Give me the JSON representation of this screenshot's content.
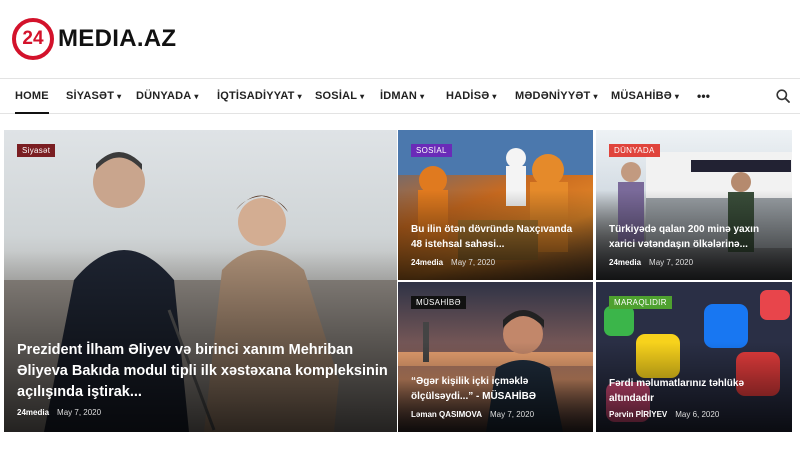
{
  "logo": {
    "mark": "24",
    "text": "MEDIA.AZ"
  },
  "nav": {
    "items": [
      {
        "label": "HOME",
        "caret": ""
      },
      {
        "label": "SİYASƏT",
        "caret": "▾"
      },
      {
        "label": "DÜNYADA",
        "caret": "▾"
      },
      {
        "label": "İQTİSADİYYAT",
        "caret": "▾"
      },
      {
        "label": "SOSİAL",
        "caret": "▾"
      },
      {
        "label": "İDMAN",
        "caret": "▾"
      },
      {
        "label": "HADİSƏ",
        "caret": "▾"
      },
      {
        "label": "MƏDƏNİYYƏT",
        "caret": "▾"
      },
      {
        "label": "MÜSAHİBƏ",
        "caret": "▾"
      }
    ],
    "more": "•••",
    "search_icon": "search-icon"
  },
  "cards": [
    {
      "category": "Siyasət",
      "title_lines": [
        "Prezident İlham Əliyev və birinci xanım Mehriban",
        "Əliyeva Bakıda modul tipli ilk xəstəxana kompleksinin",
        "açılışında iştirak..."
      ],
      "author": "24media",
      "date": "May 7, 2020"
    },
    {
      "category": "SOSİAL",
      "title_lines": [
        "Bu ilin ötən dövründə Naxçıvanda",
        "48 istehsal sahəsi..."
      ],
      "author": "24media",
      "date": "May 7, 2020"
    },
    {
      "category": "DÜNYADA",
      "title_lines": [
        "Türkiyədə qalan 200 minə yaxın",
        "xarici vətəndaşın ölkələrinə..."
      ],
      "author": "24media",
      "date": "May 7, 2020"
    },
    {
      "category": "MÜSAHİBƏ",
      "title_lines": [
        "“Əgər kişilik içki içməklə",
        "ölçülsəydi...” - MÜSAHİBƏ"
      ],
      "author": "Ləman QASIMOVA",
      "date": "May 7, 2020"
    },
    {
      "category": "MARAQLIDIR",
      "title_lines": [
        "Fərdi məlumatlarınız təhlükə",
        "altındadır"
      ],
      "author": "Pərvin PİRİYEV",
      "date": "May 6, 2020"
    }
  ]
}
